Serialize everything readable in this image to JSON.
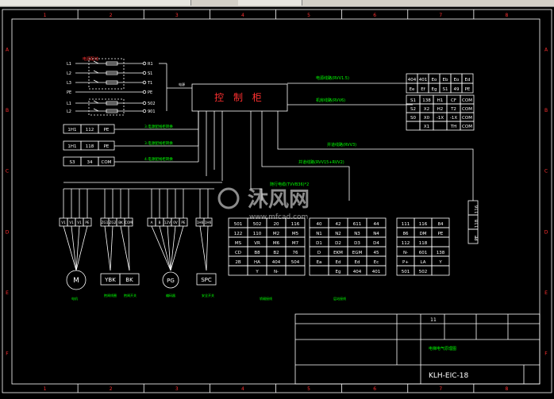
{
  "window": {
    "tabs": [
      "",
      "",
      "",
      "",
      ""
    ]
  },
  "grid": {
    "top_numbers": [
      "1",
      "2",
      "3",
      "4",
      "5",
      "6",
      "7",
      "8"
    ],
    "side_letters": [
      "A",
      "B",
      "C",
      "D",
      "E",
      "F"
    ]
  },
  "cabinet": {
    "label": "控 制 柜"
  },
  "left_top": {
    "title": "电源配线",
    "rows": [
      "L1",
      "L2",
      "L3",
      "PE",
      "L1",
      "L2"
    ],
    "outputs": [
      "R1",
      "S1",
      "T1",
      "PE",
      "502",
      "901"
    ],
    "power_label": "电源"
  },
  "left_boxes": [
    {
      "cells": [
        "1H1",
        "112",
        "PE"
      ],
      "label": "3.电源配线柜转换"
    },
    {
      "cells": [
        "1H1",
        "118",
        "PE"
      ],
      "label": "3.电源配线柜转换"
    },
    {
      "cells": [
        "S3",
        "34",
        "COM"
      ],
      "label": "4.电源配线柜转换"
    }
  ],
  "right_links": [
    {
      "label": "电源线路(RVV1.5)"
    },
    {
      "label": "机房线路(RVV6)"
    },
    {
      "label": "井道线路(RVV3)"
    },
    {
      "label": "井道线路(RVV15+RVV2)"
    },
    {
      "label": "随行电缆(TVVB36)*2"
    }
  ],
  "top_right_table": {
    "rows": [
      [
        "404",
        "401",
        "Eo",
        "Eb",
        "Eo",
        "Ed"
      ],
      [
        "Ee",
        "Ef",
        "Eg",
        "S1",
        "49",
        "PE"
      ]
    ]
  },
  "mid_right_table": {
    "rows": [
      [
        "S1",
        "138",
        "H1",
        "CF",
        "COM"
      ],
      [
        "S2",
        "X2",
        "H2",
        "T2",
        "COM"
      ],
      [
        "S0",
        "X0",
        "-1X",
        "-1X",
        "COM"
      ],
      [
        "",
        "X1",
        "",
        "TH",
        "COM"
      ]
    ]
  },
  "right_vertical_box": [
    "116",
    "118",
    "PE"
  ],
  "bottom_groups": [
    {
      "cells": [
        "V1",
        "V1",
        "V1",
        "PE"
      ],
      "label": "电机"
    },
    {
      "cells": [
        "ZG1",
        "ZG2",
        "BK",
        "COM"
      ],
      "label": "抱闸"
    },
    {
      "cells": [
        "A",
        "B",
        "12V",
        "0V",
        "PE"
      ],
      "label": "编码器"
    },
    {
      "cells": [
        "1H6",
        "1H6"
      ],
      "label": "安全开关"
    }
  ],
  "components": {
    "motor": "M",
    "ybk": "YBK",
    "bk": "BK",
    "pg": "PG",
    "spc": "SPC"
  },
  "component_labels": [
    "电机",
    "抱闸线圈",
    "抱闸开关",
    "编码器",
    "安全开关"
  ],
  "table_a": {
    "rows": [
      [
        "501",
        "502",
        "20",
        "116"
      ],
      [
        "122",
        "110",
        "M2",
        "M5"
      ],
      [
        "MS",
        "VR",
        "M6",
        "M7"
      ],
      [
        "CD",
        "B8",
        "B2",
        "76"
      ],
      [
        "2B",
        "HA",
        "404",
        "504"
      ],
      [
        "",
        "Y",
        "N-",
        ""
      ]
    ],
    "label": "轿厢接线"
  },
  "table_b": {
    "rows": [
      [
        "40",
        "42",
        "611",
        "44"
      ],
      [
        "N1",
        "N2",
        "N3",
        "N4"
      ],
      [
        "D1",
        "D2",
        "D3",
        "D4"
      ],
      [
        "D",
        "EKM",
        "EGM",
        "45"
      ],
      [
        "Ea",
        "Ed",
        "Ed",
        "Ec"
      ],
      [
        "",
        "Eg",
        "404",
        "401"
      ]
    ],
    "label": "层站接线"
  },
  "table_c": {
    "rows": [
      [
        "111",
        "116",
        "84"
      ],
      [
        "86",
        "DM",
        "PE"
      ],
      [
        "112",
        "118",
        ""
      ],
      [
        "N-",
        "601",
        "138"
      ],
      [
        "P+",
        "LA",
        "Y"
      ],
      [
        "501",
        "502",
        ""
      ]
    ]
  },
  "title_block": {
    "sheet_number": "11",
    "drawing_name": "电梯电气原理图",
    "code": "KLH-EIC-18"
  },
  "watermark": {
    "text": "沐风网",
    "url": "www.mfcad.com"
  }
}
